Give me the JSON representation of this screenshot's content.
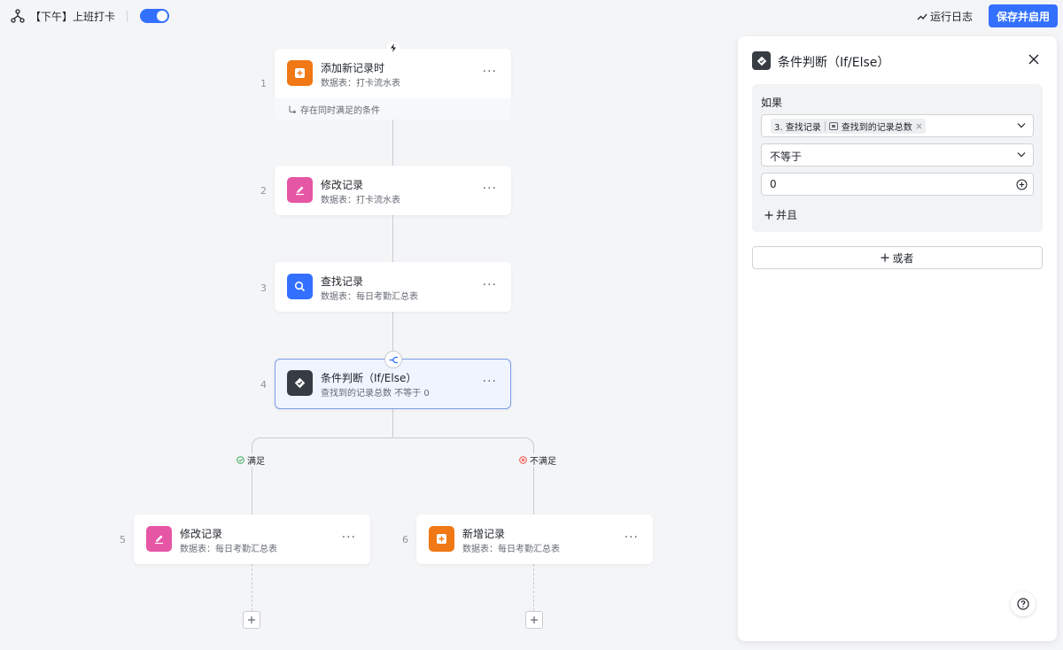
{
  "header": {
    "flow_title": "【下午】上班打卡",
    "run_log_label": "运行日志",
    "save_label": "保存并启用",
    "enabled": true
  },
  "nodes": [
    {
      "step": "1",
      "title": "添加新记录时",
      "subtitle": "数据表：打卡流水表",
      "footer": "存在同时满足的条件",
      "icon": "add-record-icon",
      "color": "#f07815"
    },
    {
      "step": "2",
      "title": "修改记录",
      "subtitle": "数据表：打卡流水表",
      "icon": "edit-icon",
      "color": "#e556a4"
    },
    {
      "step": "3",
      "title": "查找记录",
      "subtitle": "数据表：每日考勤汇总表",
      "icon": "search-icon",
      "color": "#3370ff"
    },
    {
      "step": "4",
      "title": "条件判断（If/Else）",
      "subtitle": "查找到的记录总数 不等于 0",
      "icon": "condition-icon",
      "color": "#373c43"
    },
    {
      "step": "5",
      "title": "修改记录",
      "subtitle": "数据表：每日考勤汇总表",
      "icon": "edit-icon",
      "color": "#e556a4"
    },
    {
      "step": "6",
      "title": "新增记录",
      "subtitle": "数据表：每日考勤汇总表",
      "icon": "add-record-icon",
      "color": "#f07815"
    }
  ],
  "branches": {
    "yes_label": "满足",
    "no_label": "不满足"
  },
  "panel": {
    "title": "条件判断（If/Else）",
    "if_label": "如果",
    "field_tag_step": "3. 查找记录",
    "field_tag_value": "查找到的记录总数",
    "operator": "不等于",
    "value": "0",
    "and_label": "并且",
    "or_label": "或者"
  }
}
